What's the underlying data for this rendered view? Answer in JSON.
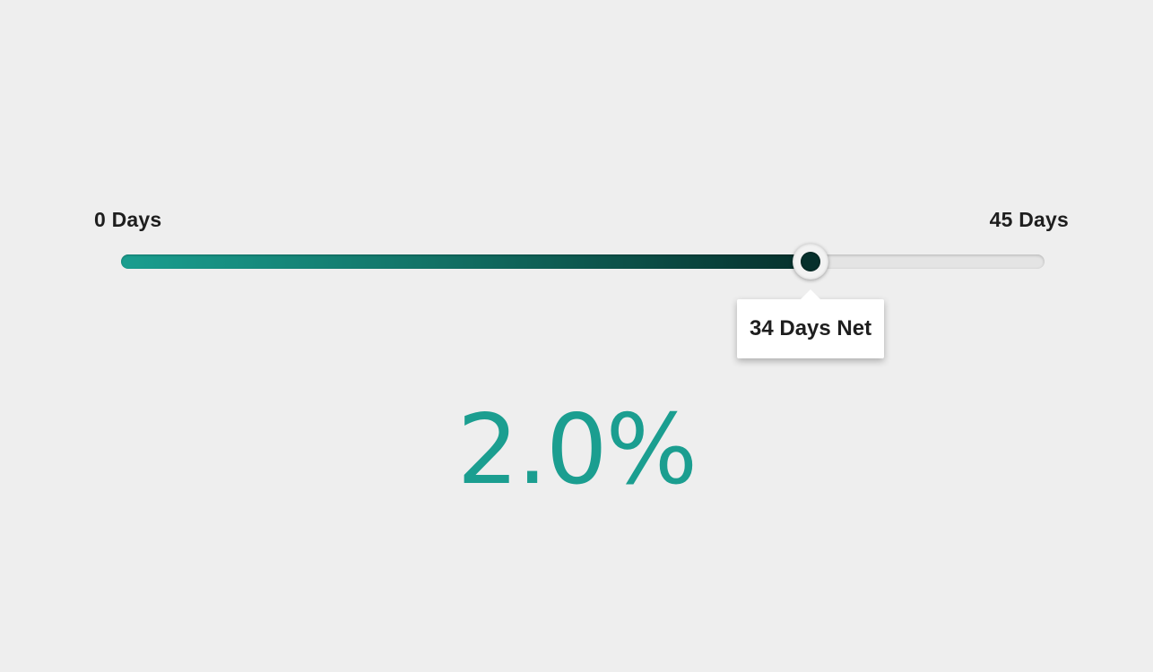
{
  "slider": {
    "min_label": "0 Days",
    "max_label": "45 Days",
    "min": 0,
    "max": 45,
    "value": 34,
    "tooltip": "34 Days Net"
  },
  "result": {
    "value_text": "2.0%"
  },
  "colors": {
    "accent": "#1b9e90",
    "fill_start": "#1a9e8f",
    "fill_end": "#06302c",
    "background": "#eeeeee"
  }
}
